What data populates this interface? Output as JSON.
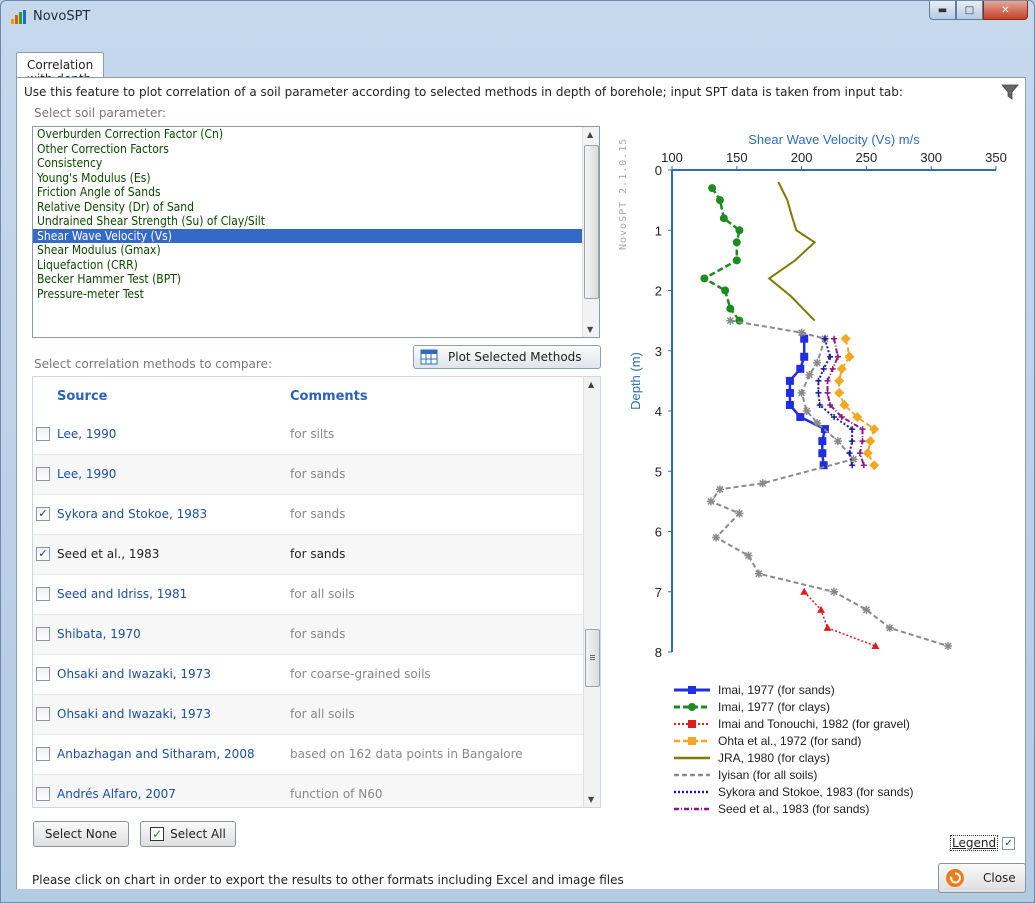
{
  "window": {
    "title": "NovoSPT"
  },
  "tabs": [
    {
      "label": "Correlation with depth"
    }
  ],
  "description": "Use this feature to plot correlation of a soil parameter according to selected methods in depth of borehole; input SPT data is taken from input tab:",
  "params_label": "Select soil parameter:",
  "params": [
    "Overburden Correction Factor (Cn)",
    "Other Correction Factors",
    "Consistency",
    "Young's Modulus (Es)",
    "Friction Angle of Sands",
    "Relative Density (Dr) of Sand",
    "Undrained Shear Strength (Su) of Clay/Silt",
    "Shear Wave Velocity (Vs)",
    "Shear Modulus (Gmax)",
    "Liquefaction (CRR)",
    "Becker Hammer Test (BPT)",
    "Pressure-meter Test"
  ],
  "params_selected": "Shear Wave Velocity (Vs)",
  "methods_label": "Select correlation methods to compare:",
  "plot_button": "Plot Selected Methods",
  "grid": {
    "col_source": "Source",
    "col_comments": "Comments",
    "rows": [
      {
        "source": "Lee, 1990",
        "comment": "for silts",
        "checked": false
      },
      {
        "source": "Lee, 1990",
        "comment": "for sands",
        "checked": false
      },
      {
        "source": "Sykora and Stokoe, 1983",
        "comment": "for sands",
        "checked": true
      },
      {
        "source": "Seed et al., 1983",
        "comment": "for sands",
        "checked": true
      },
      {
        "source": "Seed and Idriss, 1981",
        "comment": "for all soils",
        "checked": false
      },
      {
        "source": "Shibata, 1970",
        "comment": "for sands",
        "checked": false
      },
      {
        "source": "Ohsaki and Iwazaki, 1973",
        "comment": "for coarse-grained soils",
        "checked": false
      },
      {
        "source": "Ohsaki and Iwazaki, 1973",
        "comment": "for all soils",
        "checked": false
      },
      {
        "source": "Anbazhagan and Sitharam, 2008",
        "comment": "based on 162 data points in Bangalore",
        "checked": false
      },
      {
        "source": "Andrés Alfaro, 2007",
        "comment": "function of N60",
        "checked": false
      }
    ]
  },
  "select_none": "Select None",
  "select_all": "Select All",
  "watermark": "NovoSPT 2.1.0.15",
  "legend_toggle": "Legend",
  "status": "Please click on chart in order to export the results to other formats including Excel and image files",
  "close_button": "Close",
  "colors": {
    "axis": "#2f6db5",
    "selection": "#3469c7",
    "param_text": "#0c4a00"
  },
  "chart_data": {
    "type": "line",
    "title": "Shear Wave Velocity (Vs) m/s",
    "xlabel": "Shear Wave Velocity (Vs) m/s",
    "ylabel": "Depth (m)",
    "xlim": [
      100,
      350
    ],
    "ylim": [
      0,
      8
    ],
    "x_axis_position": "top",
    "y_inverted": true,
    "x_ticks": [
      100,
      150,
      200,
      250,
      300,
      350
    ],
    "y_ticks": [
      0,
      1,
      2,
      3,
      4,
      5,
      6,
      7,
      8
    ],
    "legend_position": "bottom",
    "series": [
      {
        "name": "Imai, 1977 (for sands)",
        "color": "#1f2ee0",
        "dash": "",
        "marker": "square",
        "width": 2.5,
        "points": [
          [
            202,
            2.8
          ],
          [
            202,
            3.1
          ],
          [
            199,
            3.3
          ],
          [
            191,
            3.5
          ],
          [
            191,
            3.7
          ],
          [
            191,
            3.9
          ],
          [
            199,
            4.1
          ],
          [
            218,
            4.3
          ],
          [
            216,
            4.5
          ],
          [
            216,
            4.7
          ],
          [
            217,
            4.9
          ]
        ]
      },
      {
        "name": "Imai, 1977 (for clays)",
        "color": "#1f8a1f",
        "dash": "6,3",
        "marker": "circle",
        "width": 2.5,
        "points": [
          [
            131,
            0.3
          ],
          [
            137,
            0.5
          ],
          [
            140,
            0.8
          ],
          [
            152,
            1.0
          ],
          [
            150,
            1.2
          ],
          [
            150,
            1.5
          ],
          [
            125,
            1.8
          ],
          [
            141,
            2.0
          ],
          [
            145,
            2.3
          ],
          [
            152,
            2.5
          ]
        ]
      },
      {
        "name": "Imai and Tonouchi, 1982 (for gravel)",
        "color": "#e01b1b",
        "dash": "2,2",
        "marker": "triangle",
        "width": 1.5,
        "points": [
          [
            202,
            7.0
          ],
          [
            215,
            7.3
          ],
          [
            220,
            7.6
          ],
          [
            257,
            7.9
          ]
        ]
      },
      {
        "name": "Ohta et al., 1972 (for sand)",
        "color": "#f5a623",
        "dash": "6,3",
        "marker": "diamond",
        "width": 2,
        "points": [
          [
            234,
            2.8
          ],
          [
            237,
            3.1
          ],
          [
            231,
            3.3
          ],
          [
            229,
            3.5
          ],
          [
            229,
            3.7
          ],
          [
            233,
            3.9
          ],
          [
            243,
            4.1
          ],
          [
            256,
            4.3
          ],
          [
            253,
            4.5
          ],
          [
            251,
            4.7
          ],
          [
            256,
            4.9
          ]
        ]
      },
      {
        "name": "JRA, 1980 (for clays)",
        "color": "#7f7a00",
        "dash": "",
        "marker": "line",
        "width": 2,
        "points": [
          [
            182,
            0.2
          ],
          [
            189,
            0.5
          ],
          [
            193,
            0.8
          ],
          [
            196,
            1.0
          ],
          [
            210,
            1.2
          ],
          [
            195,
            1.5
          ],
          [
            175,
            1.8
          ],
          [
            192,
            2.1
          ],
          [
            210,
            2.5
          ]
        ]
      },
      {
        "name": "Iyisan (for all soils)",
        "color": "#8a8a8a",
        "dash": "5,3",
        "marker": "star",
        "width": 2,
        "points": [
          [
            145,
            2.5
          ],
          [
            200,
            2.7
          ],
          [
            218,
            2.8
          ],
          [
            212,
            3.2
          ],
          [
            206,
            3.4
          ],
          [
            200,
            3.7
          ],
          [
            204,
            4.0
          ],
          [
            212,
            4.2
          ],
          [
            228,
            4.5
          ],
          [
            240,
            4.8
          ],
          [
            170,
            5.2
          ],
          [
            137,
            5.3
          ],
          [
            130,
            5.5
          ],
          [
            152,
            5.7
          ],
          [
            134,
            6.1
          ],
          [
            159,
            6.4
          ],
          [
            167,
            6.7
          ],
          [
            225,
            7.0
          ],
          [
            250,
            7.3
          ],
          [
            268,
            7.6
          ],
          [
            313,
            7.9
          ]
        ]
      },
      {
        "name": "Sykora and Stokoe, 1983 (for sands)",
        "color": "#1a1aa8",
        "dash": "2,2",
        "marker": "cross",
        "width": 2,
        "points": [
          [
            218,
            2.8
          ],
          [
            222,
            3.1
          ],
          [
            217,
            3.3
          ],
          [
            213,
            3.5
          ],
          [
            213,
            3.7
          ],
          [
            214,
            3.9
          ],
          [
            225,
            4.1
          ],
          [
            239,
            4.3
          ],
          [
            239,
            4.5
          ],
          [
            237,
            4.7
          ],
          [
            239,
            4.9
          ]
        ]
      },
      {
        "name": "Seed et al., 1983 (for sands)",
        "color": "#8b168b",
        "dash": "5,2,1,2",
        "marker": "cross",
        "width": 2,
        "points": [
          [
            225,
            2.8
          ],
          [
            228,
            3.1
          ],
          [
            224,
            3.3
          ],
          [
            220,
            3.5
          ],
          [
            220,
            3.7
          ],
          [
            222,
            3.9
          ],
          [
            231,
            4.1
          ],
          [
            247,
            4.3
          ],
          [
            247,
            4.5
          ],
          [
            245,
            4.7
          ],
          [
            248,
            4.9
          ]
        ]
      }
    ]
  }
}
